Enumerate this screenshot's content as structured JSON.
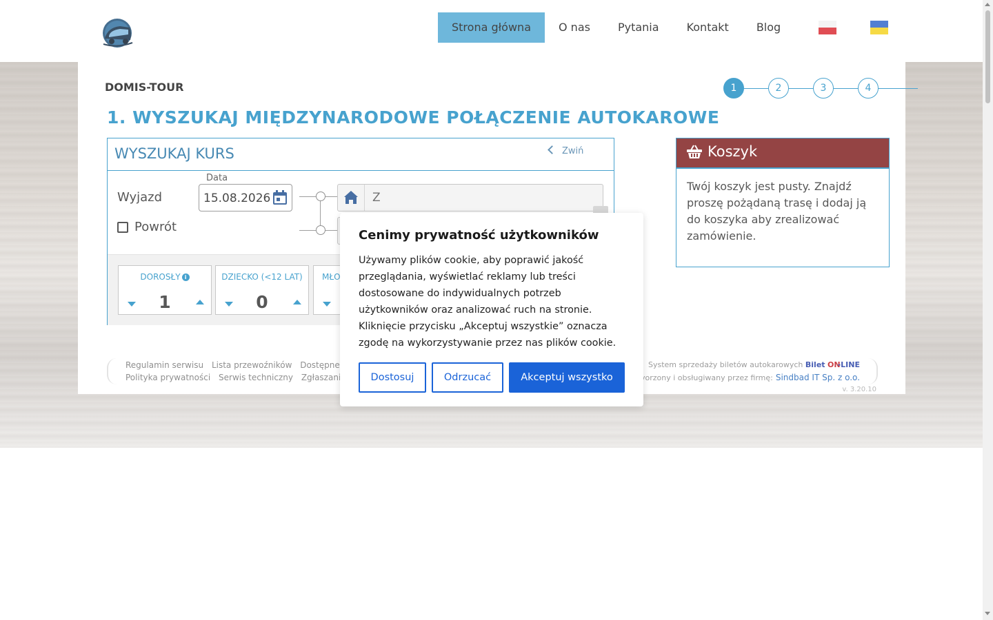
{
  "header": {
    "nav": [
      {
        "label": "Strona główna",
        "active": true
      },
      {
        "label": "O nas"
      },
      {
        "label": "Pytania"
      },
      {
        "label": "Kontakt"
      },
      {
        "label": "Blog"
      }
    ],
    "flags": [
      "flag-pl-icon",
      "flag-ua-icon"
    ],
    "colors": {
      "nav_active": "#4fa8d3",
      "accent": "#1f8ec4"
    }
  },
  "brand": "DOMIS-TOUR",
  "steps": [
    "1",
    "2",
    "3",
    "4"
  ],
  "page_title": "1. WYSZUKAJ MIĘDZYNARODOWE POŁĄCZENIE AUTOKAROWE",
  "search": {
    "title": "WYSZUKAJ KURS",
    "collapse_label": "Zwiń",
    "departure_label": "Wyjazd",
    "date_legend": "Data",
    "date_value": "15.08.2026",
    "return_label": "Powrót",
    "from_placeholder": "Z",
    "passengers": [
      {
        "label": "DOROSŁY",
        "value": "1",
        "info": "i"
      },
      {
        "label": "DZIECKO (<12 LAT)",
        "value": "0"
      },
      {
        "label": "MŁO",
        "value": ""
      }
    ]
  },
  "cart": {
    "title": "Koszyk",
    "empty_text": "Twój koszyk jest pusty. Znajdź proszę pożądaną trasę i dodaj ją do koszyka aby zrealizować zamówienie.",
    "header_color": "#7d1b1b"
  },
  "footer": {
    "row1": [
      "Regulamin serwisu",
      "Lista przewoźników",
      "Dostępne f"
    ],
    "row2": [
      "Polityka prywatności",
      "Serwis techniczny",
      "Zgłaszanie"
    ],
    "right_prefix": "System sprzedaży biletów autokarowych",
    "right_bilet": "Bilet",
    "right_on": "ON",
    "right_line": "-LINE",
    "right_row2": "vorzony i obsługiwany przez firmę:",
    "right_link": "Sindbad IT Sp. z o.o.",
    "version": "v. 3.20.10"
  },
  "cookie": {
    "title": "Cenimy prywatność użytkowników",
    "text": "Używamy plików cookie, aby poprawić jakość przeglądania, wyświetlać reklamy lub treści dostosowane do indywidualnych potrzeb użytkowników oraz analizować ruch na stronie. Kliknięcie przycisku „Akceptuj wszystkie” oznacza zgodę na wykorzystywanie przez nas plików cookie.",
    "btn_customize": "Dostosuj",
    "btn_reject": "Odrzucać",
    "btn_accept": "Akceptuj wszystko",
    "button_color": "#1a63d8"
  }
}
